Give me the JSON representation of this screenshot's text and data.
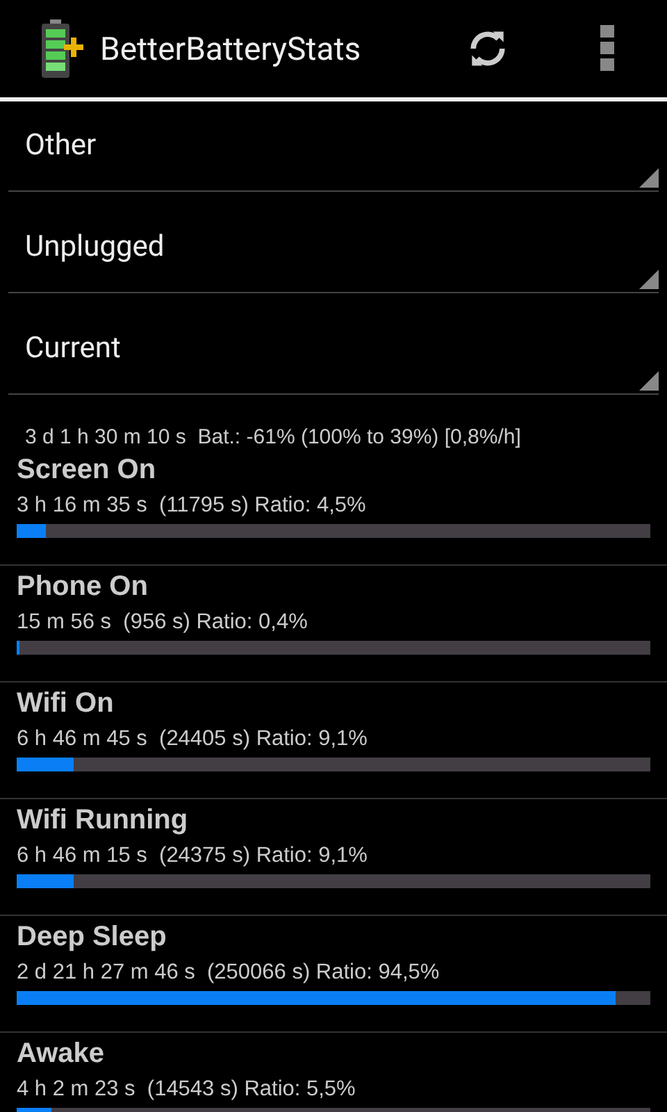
{
  "action_bar": {
    "title": "BetterBatteryStats"
  },
  "spinners": [
    {
      "value": "Other"
    },
    {
      "value": "Unplugged"
    },
    {
      "value": "Current"
    }
  ],
  "summary": "3 d 1 h 30 m 10 s  Bat.: -61% (100% to 39%) [0,8%/h]",
  "stats": [
    {
      "name": "Screen On",
      "detail": "3 h 16 m 35 s  (11795 s) Ratio: 4,5%",
      "level": 0.045
    },
    {
      "name": "Phone On",
      "detail": "15 m 56 s  (956 s) Ratio: 0,4%",
      "level": 0.004
    },
    {
      "name": "Wifi On",
      "detail": "6 h 46 m 45 s  (24405 s) Ratio: 9,1%",
      "level": 0.091
    },
    {
      "name": "Wifi Running",
      "detail": "6 h 46 m 15 s  (24375 s) Ratio: 9,1%",
      "level": 0.091
    },
    {
      "name": "Deep Sleep",
      "detail": "2 d 21 h 27 m 46 s  (250066 s) Ratio: 94,5%",
      "level": 0.945
    },
    {
      "name": "Awake",
      "detail": "4 h 2 m 23 s  (14543 s) Ratio: 5,5%",
      "level": 0.055
    }
  ]
}
